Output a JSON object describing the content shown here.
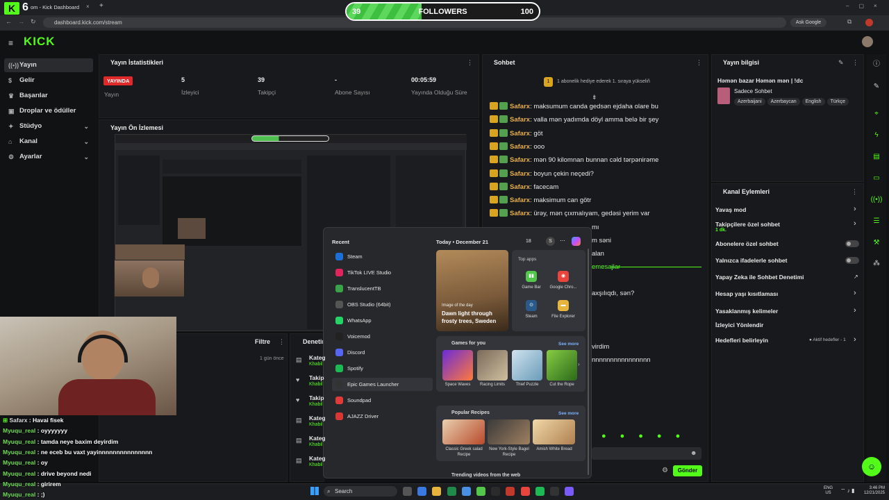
{
  "browser": {
    "tab_title": "om - Kick Dashboard",
    "url": "dashboard.kick.com/stream",
    "profile_label": "Ask Google",
    "stream_number": "6"
  },
  "follower_goal": {
    "current": "39",
    "label": "FOLLOWERS",
    "target": "100",
    "progress": 0.39
  },
  "sidebar": {
    "logo": "KICK",
    "items": [
      {
        "label": "Yayın",
        "icon": "broadcast-icon"
      },
      {
        "label": "Gelir",
        "icon": "revenue-icon"
      },
      {
        "label": "Başarılar",
        "icon": "trophy-icon"
      },
      {
        "label": "Droplar ve ödüller",
        "icon": "gift-icon"
      },
      {
        "label": "Stüdyo",
        "icon": "studio-icon"
      },
      {
        "label": "Kanal",
        "icon": "channel-icon"
      },
      {
        "label": "Ayarlar",
        "icon": "gear-icon"
      }
    ]
  },
  "stats": {
    "title": "Yayın İstatistikleri",
    "live_badge": "YAYINDA",
    "live_label": "Yayın",
    "viewers": "5",
    "viewers_label": "İzleyici",
    "followers": "39",
    "followers_label": "Takipçi",
    "subs": "-",
    "subs_label": "Abone Sayısı",
    "uptime": "00:05:59",
    "uptime_label": "Yayında Olduğu Süre"
  },
  "preview": {
    "title": "Yayın Ön İzlemesi"
  },
  "filter": {
    "label": "Filtre",
    "time": "1 gün önce"
  },
  "moderation": {
    "title": "Denetim",
    "rows": [
      "Kateg",
      "Takip",
      "Takip",
      "Kateg",
      "Kateg",
      "Kateg"
    ],
    "sub": "Khabil"
  },
  "chat": {
    "title": "Sohbet",
    "pinned": "1 abonelik hediye ederek 1. sıraya yükseliň",
    "messages": [
      {
        "user": "Safarx",
        "text": "maksumum canda gedsən ejdaha olare bu"
      },
      {
        "user": "Safarx",
        "text": "valla mən yadımda döyl amma belə bir şey"
      },
      {
        "user": "Safarx",
        "text": "göt"
      },
      {
        "user": "Safarx",
        "text": "ooo"
      },
      {
        "user": "Safarx",
        "text": "mən 90 kilomnan bunnan cəld tərpənirəme"
      },
      {
        "user": "Safarx",
        "text": "boyun çekin neçedi?"
      },
      {
        "user": "Safarx",
        "text": "facecam"
      },
      {
        "user": "Safarx",
        "text": "maksimum can götr"
      },
      {
        "user": "Safarx",
        "text": "ürəy, mən çıxmalıyam, gedəsi yerim var"
      }
    ],
    "partial": [
      "mı",
      "m səni",
      "alan",
      "emesajlar",
      "axşılıqdı, sən?",
      "virdim",
      "nnnnnnnnnnnnnnnn"
    ],
    "send_label": "Gönder"
  },
  "stream_info": {
    "title": "Yayın bilgisi",
    "stream_title": "Həmən bazar Həmən mən | !dc",
    "category": "Sadece Sohbet",
    "tags": [
      "Azerbaijani",
      "Azerbaycan",
      "English",
      "Türkçe"
    ]
  },
  "channel_actions": {
    "title": "Kanal Eylemleri",
    "items": [
      {
        "label": "Yavaş mod",
        "control": "chevron"
      },
      {
        "label": "Takipçilere özel sohbet",
        "sub": "1 dk.",
        "control": "chevron"
      },
      {
        "label": "Abonelere özel sohbet",
        "control": "toggle"
      },
      {
        "label": "Yalnızca ifadelerle sohbet",
        "control": "toggle"
      },
      {
        "label": "Yapay Zeka ile Sohbet Denetimi",
        "control": "external"
      },
      {
        "label": "Hesap yaşı kısıtlaması",
        "control": "chevron"
      },
      {
        "label": "Yasaklanmış kelimeler",
        "control": "chevron"
      },
      {
        "label": "İzleyici Yönlendir",
        "control": "none"
      },
      {
        "label": "Hedefleri belirleyin",
        "status": "Aktif hedefler - 1",
        "control": "chevron"
      }
    ]
  },
  "start_menu": {
    "recent_label": "Recent",
    "apps": [
      {
        "name": "Steam",
        "color": "#1b6fd6"
      },
      {
        "name": "TikTok LIVE Studio",
        "color": "#e0245e"
      },
      {
        "name": "TranslucentTB",
        "color": "#3aa34a"
      },
      {
        "name": "OBS Studio (64bit)",
        "color": "#555555"
      },
      {
        "name": "WhatsApp",
        "color": "#25d366"
      },
      {
        "name": "Voicemod",
        "color": "#222222"
      },
      {
        "name": "Discord",
        "color": "#5865f2"
      },
      {
        "name": "Spotify",
        "color": "#1db954"
      },
      {
        "name": "Epic Games Launcher",
        "color": "#333333"
      },
      {
        "name": "Soundpad",
        "color": "#e03a3a"
      },
      {
        "name": "AJAZZ Driver",
        "color": "#d93636"
      }
    ],
    "date_label": "Today",
    "date": "December 21",
    "temp": "18",
    "user_initial": "S",
    "image_of_day_label": "Image of the day",
    "image_title": "Dawn light through frosty trees, Sweden",
    "top_apps_label": "Top apps",
    "top_apps": [
      "Game Bar",
      "Google Chro...",
      "Steam",
      "File Explorer"
    ],
    "games_label": "Games for you",
    "games": [
      "Space Waves",
      "Racing Limits",
      "Thief Puzzle",
      "Cut the Rope"
    ],
    "recipes_label": "Popular Recipes",
    "recipes": [
      "Classic Greek salad Recipe",
      "New York-Style Bagel Recipe",
      "Amish White Bread"
    ],
    "see_more": "See more",
    "trending_label": "Trending videos from the web"
  },
  "overlay_chat": [
    {
      "user": "Safarx",
      "text": "Havai fisek"
    },
    {
      "user": "Myuqu_real",
      "text": "oyyyyyyy"
    },
    {
      "user": "Myuqu_real",
      "text": "tamda neye baxim deyirdim"
    },
    {
      "user": "Myuqu_real",
      "text": "ne eceb bu vaxt yayinnnnnnnnnnnnnnn"
    },
    {
      "user": "Myuqu_real",
      "text": "oy"
    },
    {
      "user": "Myuqu_real",
      "text": "drive beyond nedi"
    },
    {
      "user": "Myuqu_real",
      "text": "girirem"
    },
    {
      "user": "Myuqu_real",
      "text": ";)"
    }
  ],
  "taskbar": {
    "search_placeholder": "Search",
    "lang": "ENG",
    "region": "US",
    "time": "3:46 PM",
    "date": "12/21/2025"
  },
  "colors": {
    "accent": "#53fc18",
    "live": "#e02a2a",
    "panel": "#18191c"
  }
}
